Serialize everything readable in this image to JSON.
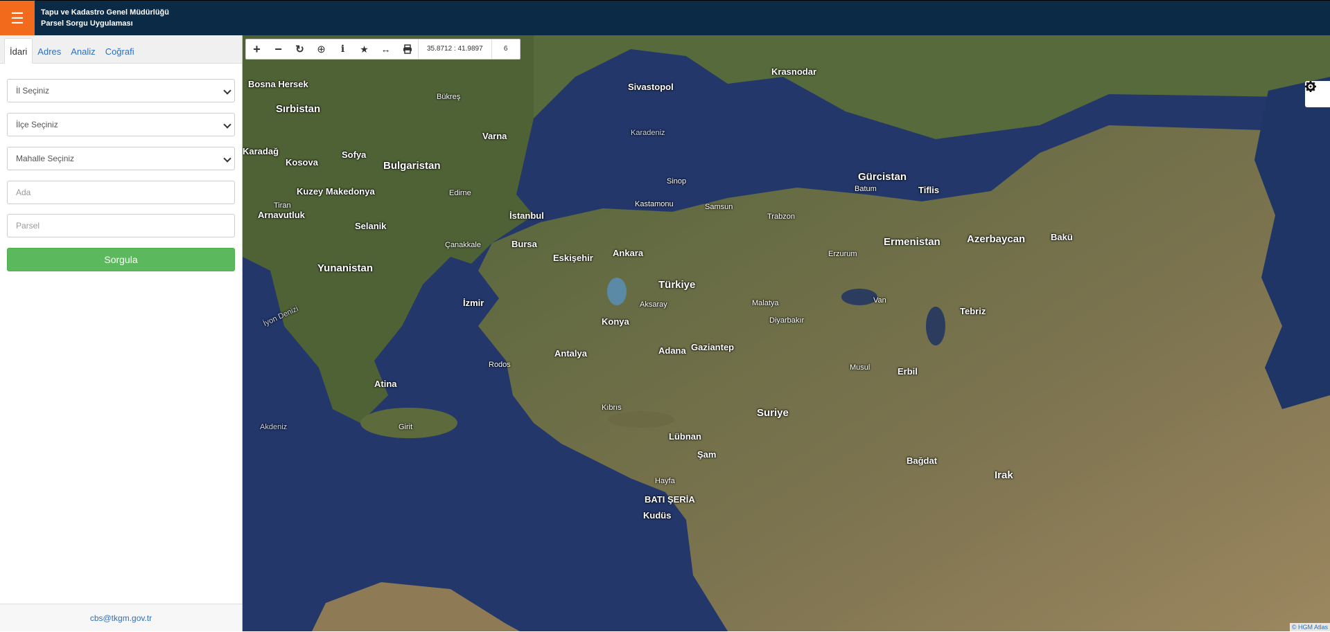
{
  "header": {
    "menu_icon": "menu-icon",
    "title_line1": "Tapu ve Kadastro Genel Müdürlüğü",
    "title_line2": "Parsel Sorgu Uygulaması"
  },
  "sidebar": {
    "tabs": [
      {
        "label": "İdari"
      },
      {
        "label": "Adres"
      },
      {
        "label": "Analiz"
      },
      {
        "label": "Coğrafi"
      }
    ],
    "selects": {
      "il": "İl Seçiniz",
      "ilce": "İlçe Seçiniz",
      "mahalle": "Mahalle Seçiniz"
    },
    "inputs": {
      "ada_placeholder": "Ada",
      "parsel_placeholder": "Parsel"
    },
    "query_button": "Sorgula",
    "footer_email": "cbs@tkgm.gov.tr"
  },
  "toolbar": {
    "coords": "35.8712 : 41.9897",
    "zoom": "6"
  },
  "map": {
    "colors": {
      "sea": "#23376b",
      "land": "#5d6a3c",
      "land_dry": "#8f7f57"
    },
    "attribution": "© HGM Atlas",
    "labels": {
      "turkiye": "Türkiye",
      "karadeniz": "Karadeniz",
      "akdeniz": "Akdeniz",
      "iyon": "İyon Denizi",
      "bulgaristan": "Bulgaristan",
      "yunanistan": "Yunanistan",
      "gurcistan": "Gürcistan",
      "ermenistan": "Ermenistan",
      "azerbaycan": "Azerbaycan",
      "suriye": "Suriye",
      "irak": "Irak",
      "lubnan": "Lübnan",
      "sirbistan": "Sırbistan",
      "bosna": "Bosna Hersek",
      "karadag": "Karadağ",
      "kosova": "Kosova",
      "kuzey_makedonya": "Kuzey Makedonya",
      "arnavutluk": "Arnavutluk",
      "istanbul": "İstanbul",
      "ankara": "Ankara",
      "izmir": "İzmir",
      "bursa": "Bursa",
      "eskisehir": "Eskişehir",
      "konya": "Konya",
      "antalya": "Antalya",
      "adana": "Adana",
      "gaziantep": "Gaziantep",
      "atina": "Atina",
      "sofya": "Sofya",
      "bukres": "Bükreş",
      "varna": "Varna",
      "tiflis": "Tiflis",
      "baku": "Bakü",
      "tebriz": "Tebriz",
      "erbil": "Erbil",
      "bagdat": "Bağdat",
      "sam": "Şam",
      "sivastopol": "Sivastopol",
      "krasnodar": "Krasnodar",
      "selanik": "Selanik",
      "tiran": "Tiran",
      "samsun": "Samsun",
      "trabzon": "Trabzon",
      "erzurum": "Erzurum",
      "van": "Van",
      "malatya": "Malatya",
      "diyarbakir": "Diyarbakır",
      "kayseri": "Aksaray",
      "kibris": "Kıbrıs",
      "girit": "Girit",
      "rodos": "Rodos",
      "batum": "Batum",
      "sinop": "Sinop",
      "kastamonu": "Kastamonu",
      "edirne": "Edirne",
      "canakkale": "Çanakkale",
      "mosul": "Musul",
      "bati_seria": "BATI ŞERİA",
      "kudus": "Kudüs",
      "hayfa": "Hayfa"
    }
  }
}
